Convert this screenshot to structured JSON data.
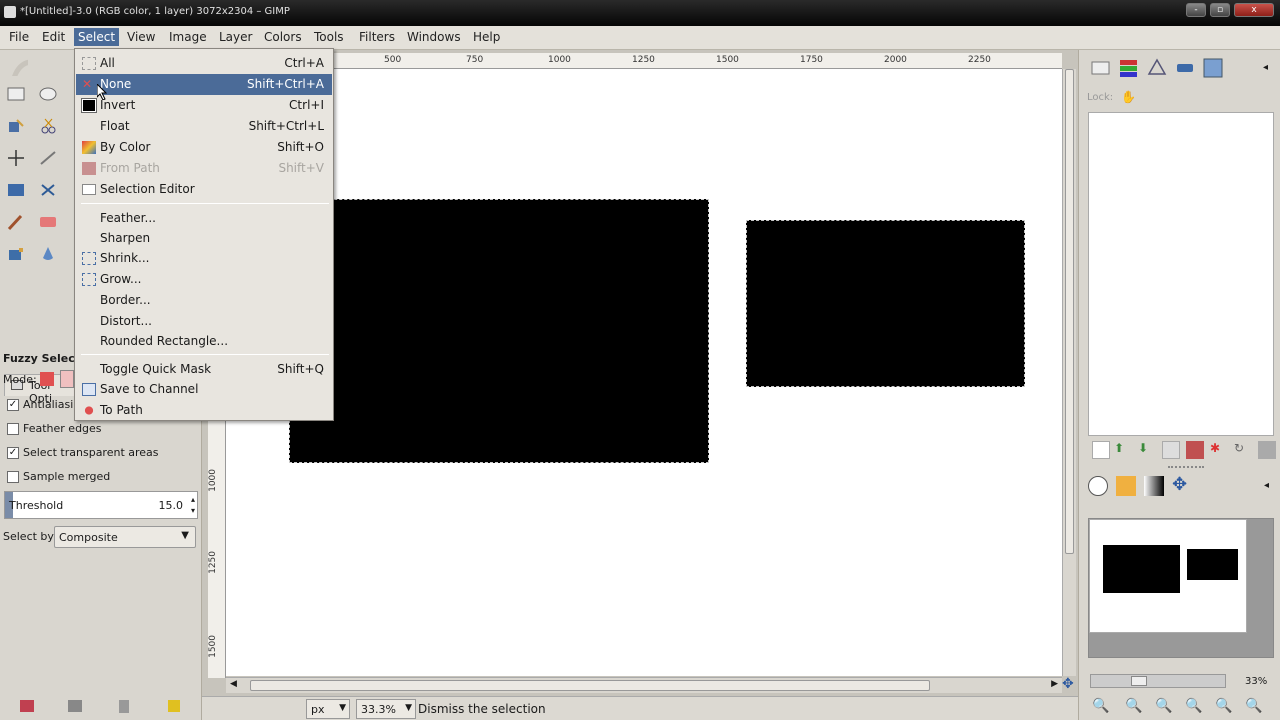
{
  "window": {
    "title": "*[Untitled]-3.0 (RGB color, 1 layer) 3072x2304 – GIMP",
    "controls": [
      "-",
      "▫",
      "x"
    ]
  },
  "menubar": [
    "File",
    "Edit",
    "Select",
    "View",
    "Image",
    "Layer",
    "Colors",
    "Tools",
    "Filters",
    "Windows",
    "Help"
  ],
  "menubar_active": "Select",
  "select_menu": {
    "items": [
      {
        "label": "All",
        "shortcut": "Ctrl+A",
        "icon": "select-all-icon",
        "state": "normal"
      },
      {
        "label": "None",
        "shortcut": "Shift+Ctrl+A",
        "icon": "select-none-icon",
        "state": "highlighted"
      },
      {
        "label": "Invert",
        "shortcut": "Ctrl+I",
        "icon": "invert-selection-icon",
        "state": "normal"
      },
      {
        "label": "Float",
        "shortcut": "Shift+Ctrl+L",
        "icon": "",
        "state": "normal"
      },
      {
        "label": "By Color",
        "shortcut": "Shift+O",
        "icon": "select-by-color-icon",
        "state": "normal"
      },
      {
        "label": "From Path",
        "shortcut": "Shift+V",
        "icon": "path-to-selection-icon",
        "state": "disabled"
      },
      {
        "label": "Selection Editor",
        "shortcut": "",
        "icon": "selection-editor-icon",
        "state": "normal"
      },
      {
        "label": "Feather...",
        "shortcut": "",
        "icon": "",
        "state": "normal"
      },
      {
        "label": "Sharpen",
        "shortcut": "",
        "icon": "",
        "state": "normal"
      },
      {
        "label": "Shrink...",
        "shortcut": "",
        "icon": "shrink-icon",
        "state": "normal"
      },
      {
        "label": "Grow...",
        "shortcut": "",
        "icon": "grow-icon",
        "state": "normal"
      },
      {
        "label": "Border...",
        "shortcut": "",
        "icon": "",
        "state": "normal"
      },
      {
        "label": "Distort...",
        "shortcut": "",
        "icon": "",
        "state": "normal"
      },
      {
        "label": "Rounded Rectangle...",
        "shortcut": "",
        "icon": "",
        "state": "normal"
      },
      {
        "label": "Toggle Quick Mask",
        "shortcut": "Shift+Q",
        "icon": "",
        "state": "normal"
      },
      {
        "label": "Save to Channel",
        "shortcut": "",
        "icon": "save-to-channel-icon",
        "state": "normal"
      },
      {
        "label": "To Path",
        "shortcut": "",
        "icon": "to-path-icon",
        "state": "normal"
      }
    ]
  },
  "tool_options": {
    "tab_label": "Tool Opti",
    "tool_name": "Fuzzy Select",
    "mode_label": "Mode:",
    "antialiasing": {
      "label": "Antialiasin",
      "checked": true
    },
    "feather_edges": {
      "label": "Feather edges",
      "checked": false
    },
    "select_transparent": {
      "label": "Select transparent areas",
      "checked": true
    },
    "sample_merged": {
      "label": "Sample merged",
      "checked": false
    },
    "threshold": {
      "label": "Threshold",
      "value": "15.0"
    },
    "select_by": {
      "label": "Select by:",
      "value": "Composite"
    }
  },
  "ruler": {
    "h_ticks": [
      "500",
      "750",
      "1000",
      "1250",
      "1500",
      "1750",
      "2000",
      "2250"
    ],
    "v_ticks": [
      "1000",
      "1250",
      "1500"
    ]
  },
  "statusbar": {
    "unit": "px",
    "zoom": "33.3%",
    "message": "Dismiss the selection"
  },
  "right_dock": {
    "lock_label": "Lock:",
    "nav_zoom": "33%"
  },
  "colors": {
    "menu_highlight": "#4b6b98",
    "canvas": "#ffffff",
    "shape": "#000000"
  }
}
